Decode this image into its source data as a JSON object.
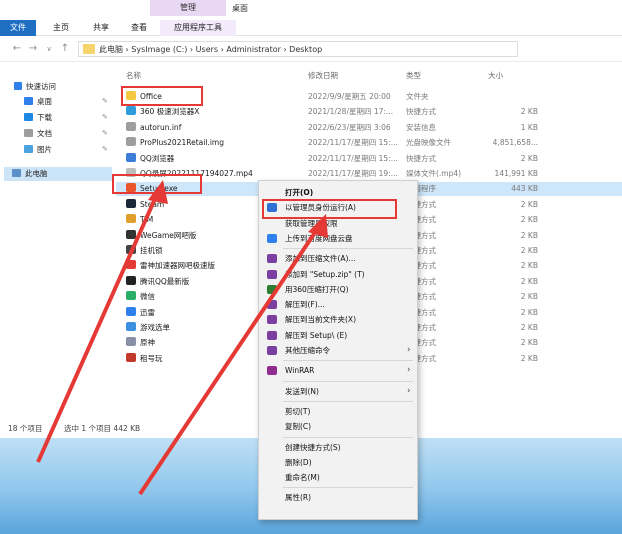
{
  "ribbon": {
    "context_tab_title": "管理",
    "window_title": "桌面",
    "tabs": [
      "文件",
      "主页",
      "共享",
      "查看",
      "应用程序工具"
    ]
  },
  "address": {
    "path": "此电脑 › SysImage (C:) › Users › Administrator › Desktop",
    "nav_buttons": [
      "back",
      "forward",
      "dropdown",
      "up"
    ]
  },
  "nav_pane": {
    "quick_access": "快速访问",
    "items": [
      {
        "label": "桌面",
        "pinned": true
      },
      {
        "label": "下载",
        "pinned": true
      },
      {
        "label": "文档",
        "pinned": true
      },
      {
        "label": "图片",
        "pinned": true
      }
    ],
    "this_pc": "此电脑"
  },
  "columns": {
    "name": "名称",
    "date": "修改日期",
    "type": "类型",
    "size": "大小"
  },
  "files": [
    {
      "name": "Office",
      "date": "2022/9/9/星期五 20:00",
      "type": "文件夹",
      "size": "",
      "color": "#f5c842"
    },
    {
      "name": "360 极速浏览器X",
      "date": "2021/1/28/星期四 17:...",
      "type": "快捷方式",
      "size": "2 KB",
      "color": "#2d9cdb"
    },
    {
      "name": "autorun.inf",
      "date": "2022/6/23/星期四 3:06",
      "type": "安装信息",
      "size": "1 KB",
      "color": "#9e9e9e"
    },
    {
      "name": "ProPlus2021Retail.img",
      "date": "2022/11/17/星期四 15:...",
      "type": "光盘映像文件",
      "size": "4,851,658...",
      "color": "#9e9e9e"
    },
    {
      "name": "QQ浏览器",
      "date": "2022/11/17/星期四 15:...",
      "type": "快捷方式",
      "size": "2 KB",
      "color": "#3b7dd8"
    },
    {
      "name": "QQ录屏20221117194027.mp4",
      "date": "2022/11/17/星期四 19:...",
      "type": "媒体文件(.mp4)",
      "size": "141,991 KB",
      "color": "#bdbdbd"
    },
    {
      "name": "Setup.exe",
      "date": "",
      "type": "应用程序",
      "size": "443 KB",
      "color": "#e8562a"
    },
    {
      "name": "Steam",
      "date": "",
      "type": "快捷方式",
      "size": "2 KB",
      "color": "#1b2838"
    },
    {
      "name": "TIM",
      "date": "",
      "type": "快捷方式",
      "size": "2 KB",
      "color": "#e0a030"
    },
    {
      "name": "WeGame网吧版",
      "date": "",
      "type": "快捷方式",
      "size": "2 KB",
      "color": "#333333"
    },
    {
      "name": "挂机锁",
      "date": "",
      "type": "快捷方式",
      "size": "2 KB",
      "color": "#444444"
    },
    {
      "name": "雷神加速器网吧极速版",
      "date": "",
      "type": "快捷方式",
      "size": "2 KB",
      "color": "#e53935"
    },
    {
      "name": "腾讯QQ最新版",
      "date": "",
      "type": "快捷方式",
      "size": "2 KB",
      "color": "#222222"
    },
    {
      "name": "微信",
      "date": "",
      "type": "快捷方式",
      "size": "2 KB",
      "color": "#2aae67"
    },
    {
      "name": "迅雷",
      "date": "",
      "type": "快捷方式",
      "size": "2 KB",
      "color": "#2f80ed"
    },
    {
      "name": "游戏选单",
      "date": "",
      "type": "快捷方式",
      "size": "2 KB",
      "color": "#3b8fe0"
    },
    {
      "name": "原神",
      "date": "",
      "type": "快捷方式",
      "size": "2 KB",
      "color": "#8a8fa8"
    },
    {
      "name": "租号玩",
      "date": "",
      "type": "快捷方式",
      "size": "2 KB",
      "color": "#c0392b"
    }
  ],
  "selected_index": 6,
  "status": {
    "count": "18 个项目",
    "selection": "选中 1 个项目  442 KB"
  },
  "context_menu": [
    {
      "label": "打开(O)",
      "bold": true,
      "icon": "",
      "color": ""
    },
    {
      "label": "以管理员身份运行(A)",
      "icon": "shield-icon",
      "color": "#2f6fd6"
    },
    {
      "label": "获取管理员权限",
      "icon": "",
      "color": ""
    },
    {
      "label": "上传到百度网盘云盘",
      "icon": "cloud-icon",
      "color": "#2f80ed"
    },
    {
      "sep": true
    },
    {
      "label": "添加到压缩文件(A)...",
      "icon": "archive-icon",
      "color": "#7b3fa0"
    },
    {
      "label": "添加到 \"Setup.zip\" (T)",
      "icon": "archive-icon",
      "color": "#7b3fa0"
    },
    {
      "label": "用360压缩打开(Q)",
      "icon": "archive-icon",
      "color": "#2e7d32"
    },
    {
      "label": "解压到(F)...",
      "icon": "archive-icon",
      "color": "#7b3fa0"
    },
    {
      "label": "解压到当前文件夹(X)",
      "icon": "archive-icon",
      "color": "#7b3fa0"
    },
    {
      "label": "解压到 Setup\\ (E)",
      "icon": "archive-icon",
      "color": "#7b3fa0"
    },
    {
      "label": "其他压缩命令",
      "icon": "archive-icon",
      "color": "#7b3fa0",
      "submenu": true
    },
    {
      "sep": true
    },
    {
      "label": "WinRAR",
      "icon": "winrar-icon",
      "color": "#8e2d8e",
      "submenu": true
    },
    {
      "sep": true
    },
    {
      "label": "发送到(N)",
      "icon": "",
      "color": "",
      "submenu": true
    },
    {
      "sep": true
    },
    {
      "label": "剪切(T)",
      "icon": "",
      "color": ""
    },
    {
      "label": "复制(C)",
      "icon": "",
      "color": ""
    },
    {
      "sep": true
    },
    {
      "label": "创建快捷方式(S)",
      "icon": "",
      "color": ""
    },
    {
      "label": "删除(D)",
      "icon": "",
      "color": ""
    },
    {
      "label": "重命名(M)",
      "icon": "",
      "color": ""
    },
    {
      "sep": true
    },
    {
      "label": "属性(R)",
      "icon": "",
      "color": ""
    }
  ],
  "highlight_color": "#e53935"
}
